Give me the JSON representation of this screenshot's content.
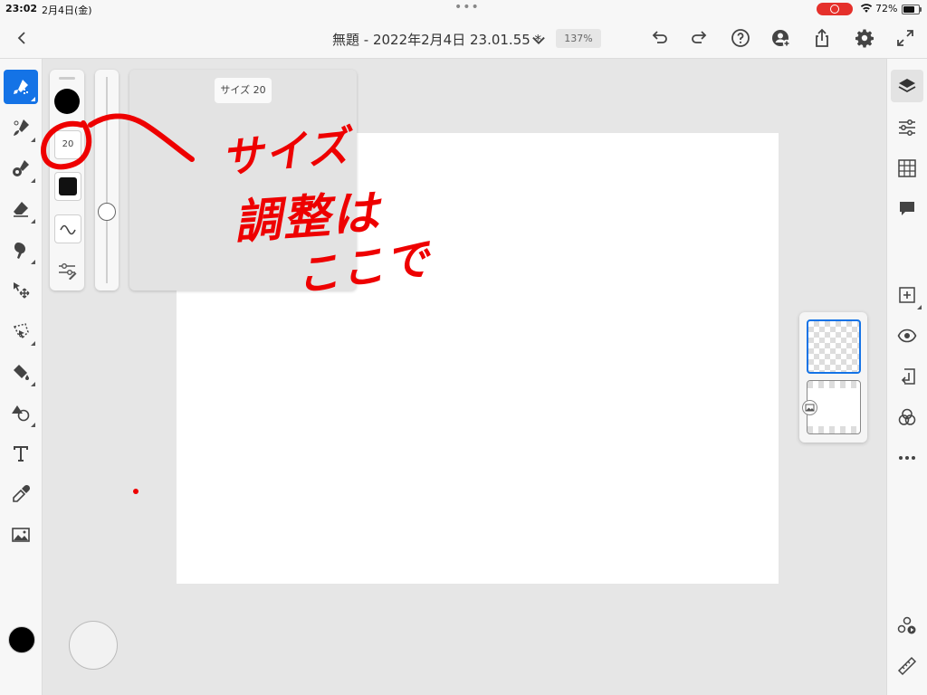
{
  "status_bar": {
    "time": "23:02",
    "date": "2月4日(金)",
    "battery": "72%",
    "battery_level": 0.72
  },
  "top_bar": {
    "document_title": "無題 - 2022年2月4日 23.01.55 *",
    "zoom": "137%",
    "icons": [
      "back-icon",
      "chevron-down-icon",
      "undo-icon",
      "redo-icon",
      "help-icon",
      "invite-user-icon",
      "share-icon",
      "settings-icon",
      "fullscreen-icon"
    ]
  },
  "left_toolbar": {
    "tools": [
      {
        "name": "pixel-brush",
        "active": true
      },
      {
        "name": "live-brush"
      },
      {
        "name": "mixer-brush"
      },
      {
        "name": "eraser"
      },
      {
        "name": "smudge"
      },
      {
        "name": "move-transform"
      },
      {
        "name": "lasso-select"
      },
      {
        "name": "fill"
      },
      {
        "name": "shapes"
      },
      {
        "name": "text"
      },
      {
        "name": "eyedropper"
      },
      {
        "name": "place-image"
      }
    ],
    "current_color": "#000000"
  },
  "brush_panel": {
    "size_value": "20",
    "size_tooltip": "サイズ 20",
    "brush_color": "#000000",
    "slider_level": 0.35
  },
  "annotation": {
    "line1": "サイズ",
    "line2": "調整は",
    "line3": "ここで",
    "color": "#ee0000"
  },
  "right_toolbar": {
    "tools": [
      "layers",
      "layer-properties",
      "grid",
      "comments",
      "add-layer",
      "visibility",
      "merge-down",
      "blend-mode",
      "more",
      "livestream",
      "ruler"
    ]
  },
  "colors": {
    "accent": "#1473e6",
    "background": "#e6e6e6",
    "toolbar": "#f7f7f7"
  }
}
